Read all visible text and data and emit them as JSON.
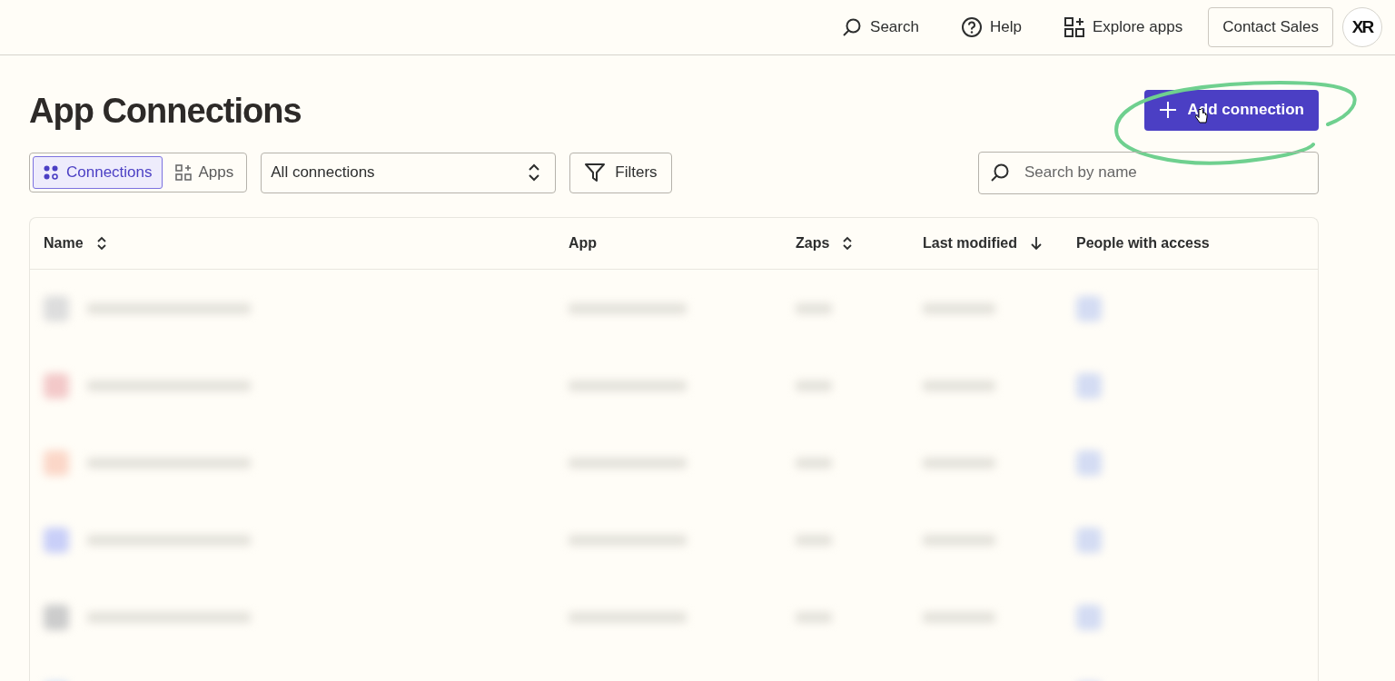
{
  "top_nav": {
    "items": [
      {
        "kind": "search",
        "label": "Search"
      },
      {
        "kind": "help",
        "label": "Help"
      },
      {
        "kind": "apps",
        "label": "Explore apps"
      }
    ],
    "contact_button": "Contact Sales",
    "avatar": "XR"
  },
  "page_title": "App Connections",
  "add_button": "Add connection",
  "view_tabs": [
    {
      "kind": "connections",
      "label": "Connections",
      "selected": true
    },
    {
      "kind": "apps",
      "label": "Apps",
      "selected": false
    }
  ],
  "connection_filter": {
    "value": "All connections"
  },
  "filters_button": "Filters",
  "search": {
    "placeholder": "Search by name"
  },
  "table": {
    "columns": [
      {
        "label": "Name",
        "kind": "sortable"
      },
      {
        "label": "App",
        "kind": "plain"
      },
      {
        "label": "Zaps",
        "kind": "sortable"
      },
      {
        "label": "Last modified",
        "kind": "sorted"
      },
      {
        "label": "People with access",
        "kind": "plain"
      }
    ]
  }
}
